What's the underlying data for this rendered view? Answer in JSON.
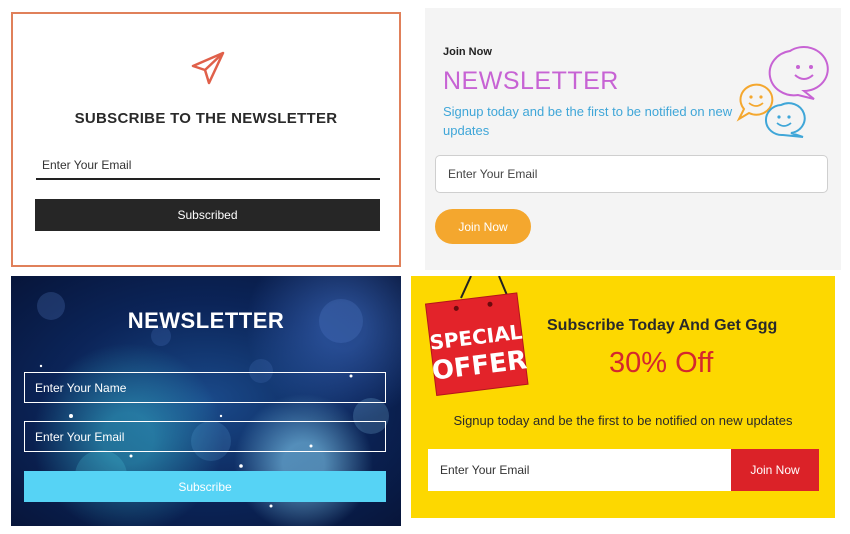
{
  "cards": {
    "minimal": {
      "icon": "paper-plane-icon",
      "title": "SUBSCRIBE TO THE NEWSLETTER",
      "email_placeholder": "Enter Your Email",
      "button_label": "Subscribed",
      "accent": "#e0805a"
    },
    "chat": {
      "kicker": "Join Now",
      "title": "NEWSLETTER",
      "description": "Signup today and be the first to be notified on new updates",
      "icon": "chat-bubbles-smiley-icon",
      "email_placeholder": "Enter Your Email",
      "button_label": "Join Now",
      "title_color": "#c763d4",
      "description_color": "#3fa6d8",
      "button_color": "#f4a72e"
    },
    "galaxy": {
      "title": "NEWSLETTER",
      "name_placeholder": "Enter Your Name",
      "email_placeholder": "Enter Your Email",
      "button_label": "Subscribe",
      "button_color": "#56d3f5"
    },
    "offer": {
      "tag_line1": "SPECIAL",
      "tag_line2": "OFFER",
      "heading": "Subscribe Today And Get Ggg",
      "offer": "30% Off",
      "description": "Signup today and be the first to be notified on new updates",
      "email_placeholder": "Enter Your Email",
      "button_label": "Join Now",
      "background": "#fdd800",
      "accent": "#db2228"
    }
  }
}
